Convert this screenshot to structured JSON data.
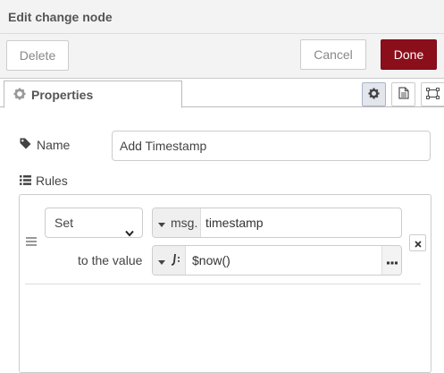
{
  "dialog": {
    "title": "Edit change node"
  },
  "actions": {
    "delete_label": "Delete",
    "cancel_label": "Cancel",
    "done_label": "Done"
  },
  "tabs": {
    "properties_label": "Properties",
    "icons": [
      "gear-icon",
      "description-icon",
      "appearance-icon"
    ]
  },
  "form": {
    "name_label": "Name",
    "name_value": "Add Timestamp",
    "rules_label": "Rules"
  },
  "rules": [
    {
      "action": "Set",
      "target_type": "msg.",
      "target_value": "timestamp",
      "to_label": "to the value",
      "value_type_icon": "expression-icon",
      "value": "$now()"
    }
  ],
  "colors": {
    "primary_button": "#8b0f1b",
    "header_bg": "#f3f3f3"
  }
}
